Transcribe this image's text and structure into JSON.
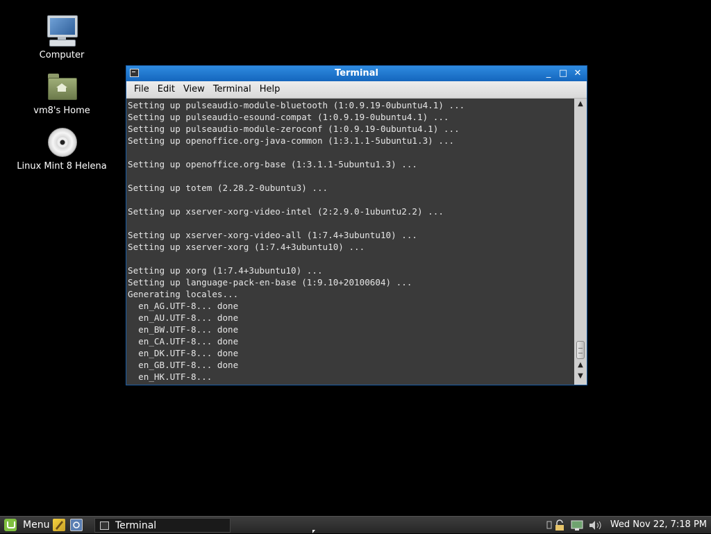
{
  "desktop": {
    "icons": [
      {
        "label": "Computer",
        "icon": "computer-icon"
      },
      {
        "label": "vm8's Home",
        "icon": "home-folder-icon"
      },
      {
        "label": "Linux Mint 8 Helena",
        "icon": "cd-disc-icon"
      }
    ]
  },
  "window": {
    "title": "Terminal",
    "controls": {
      "minimize": "_",
      "maximize": "□",
      "close": "✕"
    },
    "menu": [
      "File",
      "Edit",
      "View",
      "Terminal",
      "Help"
    ],
    "terminal_lines": [
      "Setting up pulseaudio-module-bluetooth (1:0.9.19-0ubuntu4.1) ...",
      "Setting up pulseaudio-esound-compat (1:0.9.19-0ubuntu4.1) ...",
      "Setting up pulseaudio-module-zeroconf (1:0.9.19-0ubuntu4.1) ...",
      "Setting up openoffice.org-java-common (1:3.1.1-5ubuntu1.3) ...",
      "",
      "Setting up openoffice.org-base (1:3.1.1-5ubuntu1.3) ...",
      "",
      "Setting up totem (2.28.2-0ubuntu3) ...",
      "",
      "Setting up xserver-xorg-video-intel (2:2.9.0-1ubuntu2.2) ...",
      "",
      "Setting up xserver-xorg-video-all (1:7.4+3ubuntu10) ...",
      "Setting up xserver-xorg (1:7.4+3ubuntu10) ...",
      "",
      "Setting up xorg (1:7.4+3ubuntu10) ...",
      "Setting up language-pack-en-base (1:9.10+20100604) ...",
      "Generating locales...",
      "  en_AG.UTF-8... done",
      "  en_AU.UTF-8... done",
      "  en_BW.UTF-8... done",
      "  en_CA.UTF-8... done",
      "  en_DK.UTF-8... done",
      "  en_GB.UTF-8... done",
      "  en_HK.UTF-8..."
    ]
  },
  "taskbar": {
    "menu_label": "Menu",
    "task_label": "Terminal",
    "clock": "Wed Nov 22,  7:18 PM"
  }
}
